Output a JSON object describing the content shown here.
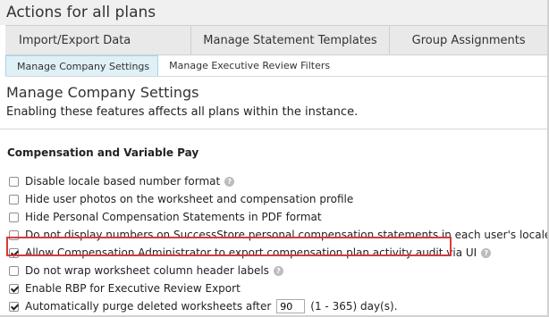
{
  "header": {
    "title": "Actions for all plans"
  },
  "tabs": [
    {
      "label": "Import/Export Data"
    },
    {
      "label": "Manage Statement Templates"
    },
    {
      "label": "Group Assignments"
    }
  ],
  "subtabs": [
    {
      "label": "Manage Company Settings",
      "active": true
    },
    {
      "label": "Manage Executive Review Filters",
      "active": false
    }
  ],
  "section": {
    "title": "Manage Company Settings",
    "description": "Enabling these features affects all plans within the instance."
  },
  "group": {
    "title": "Compensation and Variable Pay",
    "options": [
      {
        "label": "Disable locale based number format",
        "checked": false,
        "help": true
      },
      {
        "label": "Hide user photos on the worksheet and compensation profile",
        "checked": false,
        "help": false
      },
      {
        "label": "Hide Personal Compensation Statements in PDF format",
        "checked": false,
        "help": false
      },
      {
        "label": "Do not display numbers on SuccessStore personal compensation statements in each user's locale",
        "checked": false,
        "help": true
      },
      {
        "label": "Allow Compensation Administrator to export compensation plan activity audit via UI",
        "checked": true,
        "help": true,
        "highlighted": true
      },
      {
        "label": "Do not wrap worksheet column header labels",
        "checked": false,
        "help": true
      },
      {
        "label": "Enable RBP for Executive Review Export",
        "checked": true,
        "help": false
      },
      {
        "label": "Automatically purge deleted worksheets after",
        "checked": true,
        "help": false,
        "input_value": "90",
        "suffix": "(1 - 365) day(s)."
      }
    ]
  },
  "icons": {
    "help": "help-circle-icon",
    "checkbox": "checkbox"
  },
  "colors": {
    "highlight_border": "#d83a3a",
    "active_subtab_bg": "#dff0f7"
  }
}
